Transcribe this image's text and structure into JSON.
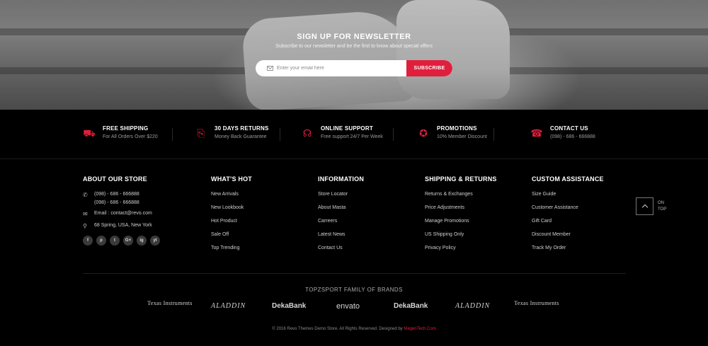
{
  "newsletter": {
    "title": "SIGN UP FOR NEWSLETTER",
    "subtitle": "Subscribe to our newsletter and be the first to know about special offers",
    "placeholder": "Enter your email here",
    "button": "SUBSCRIBE"
  },
  "features": [
    {
      "icon": "truck-icon",
      "title": "FREE SHIPPING",
      "sub": "For All Orders Over $220"
    },
    {
      "icon": "return-box-icon",
      "title": "30 DAYS RETURNS",
      "sub": "Money Back Guarantee"
    },
    {
      "icon": "headset-icon",
      "title": "ONLINE SUPPORT",
      "sub": "Free support 24/7 Per Week"
    },
    {
      "icon": "sale-tag-icon",
      "title": "PROMOTIONS",
      "sub": "10% Member Discount"
    },
    {
      "icon": "phone-icon",
      "title": "CONTACT US",
      "sub": "(098) - 686 - 666888"
    }
  ],
  "about": {
    "heading": "ABOUT OUR STORE",
    "phone1": "(098) - 686 - 666888",
    "phone2": "(098) - 686 - 666888",
    "email": "Email : contact@revo.com",
    "address": "68 Spring, USA, New York",
    "social": [
      "f",
      "p",
      "t",
      "G+",
      "ig",
      "yt"
    ]
  },
  "columns": [
    {
      "heading": "WHAT'S HOT",
      "items": [
        "New Arrivals",
        "New Lookbook",
        "Hot Product",
        "Sale Off",
        "Top Trending"
      ]
    },
    {
      "heading": "INFORMATION",
      "items": [
        "Store Locator",
        "About Masta",
        "Carreers",
        "Latest News",
        "Contact Us"
      ]
    },
    {
      "heading": "SHIPPING & RETURNS",
      "items": [
        "Returns & Exchanges",
        "Price Adjustments",
        "Manage Promotions",
        "US Shipping Only",
        "Privacy Policy"
      ]
    },
    {
      "heading": "CUSTOM ASSISTANCE",
      "items": [
        "Size Guide",
        "Customer Assistance",
        "Gift Card",
        "Discount Member",
        "Track My Order"
      ]
    }
  ],
  "ontop": {
    "line1": "ON",
    "line2": "TOP"
  },
  "brands": {
    "title": "TOPZSPORT FAMILY OF BRANDS",
    "items": [
      "Texas Instruments",
      "ALADDIN",
      "DekaBank",
      "envato",
      "DekaBank",
      "ALADDIN",
      "Texas Instruments"
    ]
  },
  "copyright": {
    "text": "© 2016 Revo Themes Demo Store. All Rights Reserved. Designed by ",
    "link": "MagenTech.Com"
  },
  "colors": {
    "accent": "#e01f3d",
    "background": "#000000"
  }
}
